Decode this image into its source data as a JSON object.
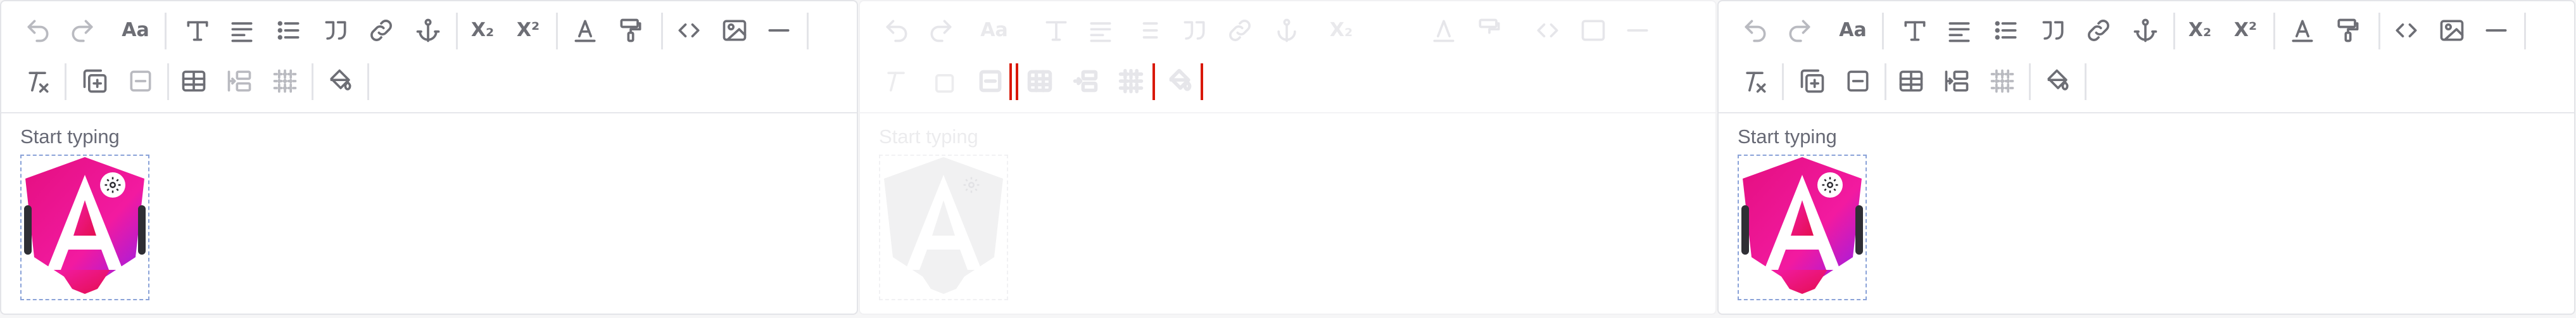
{
  "editors": [
    {
      "state": "active",
      "toolbar_row1": [
        {
          "name": "undo-button",
          "icon": "undo-icon",
          "disabled": true
        },
        {
          "name": "redo-button",
          "icon": "redo-icon",
          "disabled": true
        },
        {
          "name": "font-size-button",
          "icon": "font-size-icon",
          "text": "Aa"
        },
        {
          "name": "heading-button",
          "icon": "heading-icon"
        },
        {
          "name": "align-button",
          "icon": "align-left-icon"
        },
        {
          "name": "bullet-list-button",
          "icon": "bullet-list-icon"
        },
        {
          "name": "blockquote-button",
          "icon": "blockquote-icon"
        },
        {
          "name": "link-button",
          "icon": "link-icon"
        },
        {
          "name": "anchor-button",
          "icon": "anchor-icon"
        },
        {
          "name": "subscript-button",
          "icon": "subscript-icon",
          "text": "X₂"
        },
        {
          "name": "superscript-button",
          "icon": "superscript-icon",
          "text": "X²"
        },
        {
          "name": "text-color-button",
          "icon": "text-color-icon"
        },
        {
          "name": "format-painter-button",
          "icon": "paint-roller-icon"
        },
        {
          "name": "code-button",
          "icon": "code-icon"
        },
        {
          "name": "image-button",
          "icon": "image-icon"
        },
        {
          "name": "horizontal-rule-button",
          "icon": "horizontal-rule-icon"
        }
      ],
      "placeholder": "Start typing"
    },
    {
      "state": "faded",
      "placeholder": "Start typing"
    },
    {
      "state": "active",
      "placeholder": "Start typing"
    }
  ],
  "colors": {
    "icon": "#6d6e75",
    "icon_disabled": "#b9bac0",
    "border": "#e3e4e8",
    "image_outline": "#8aa2d8",
    "table_tool_red": "#e01a0a",
    "logo_pink": "#e40f80",
    "logo_magenta": "#f21aa0",
    "logo_purple": "#8e1df0"
  }
}
